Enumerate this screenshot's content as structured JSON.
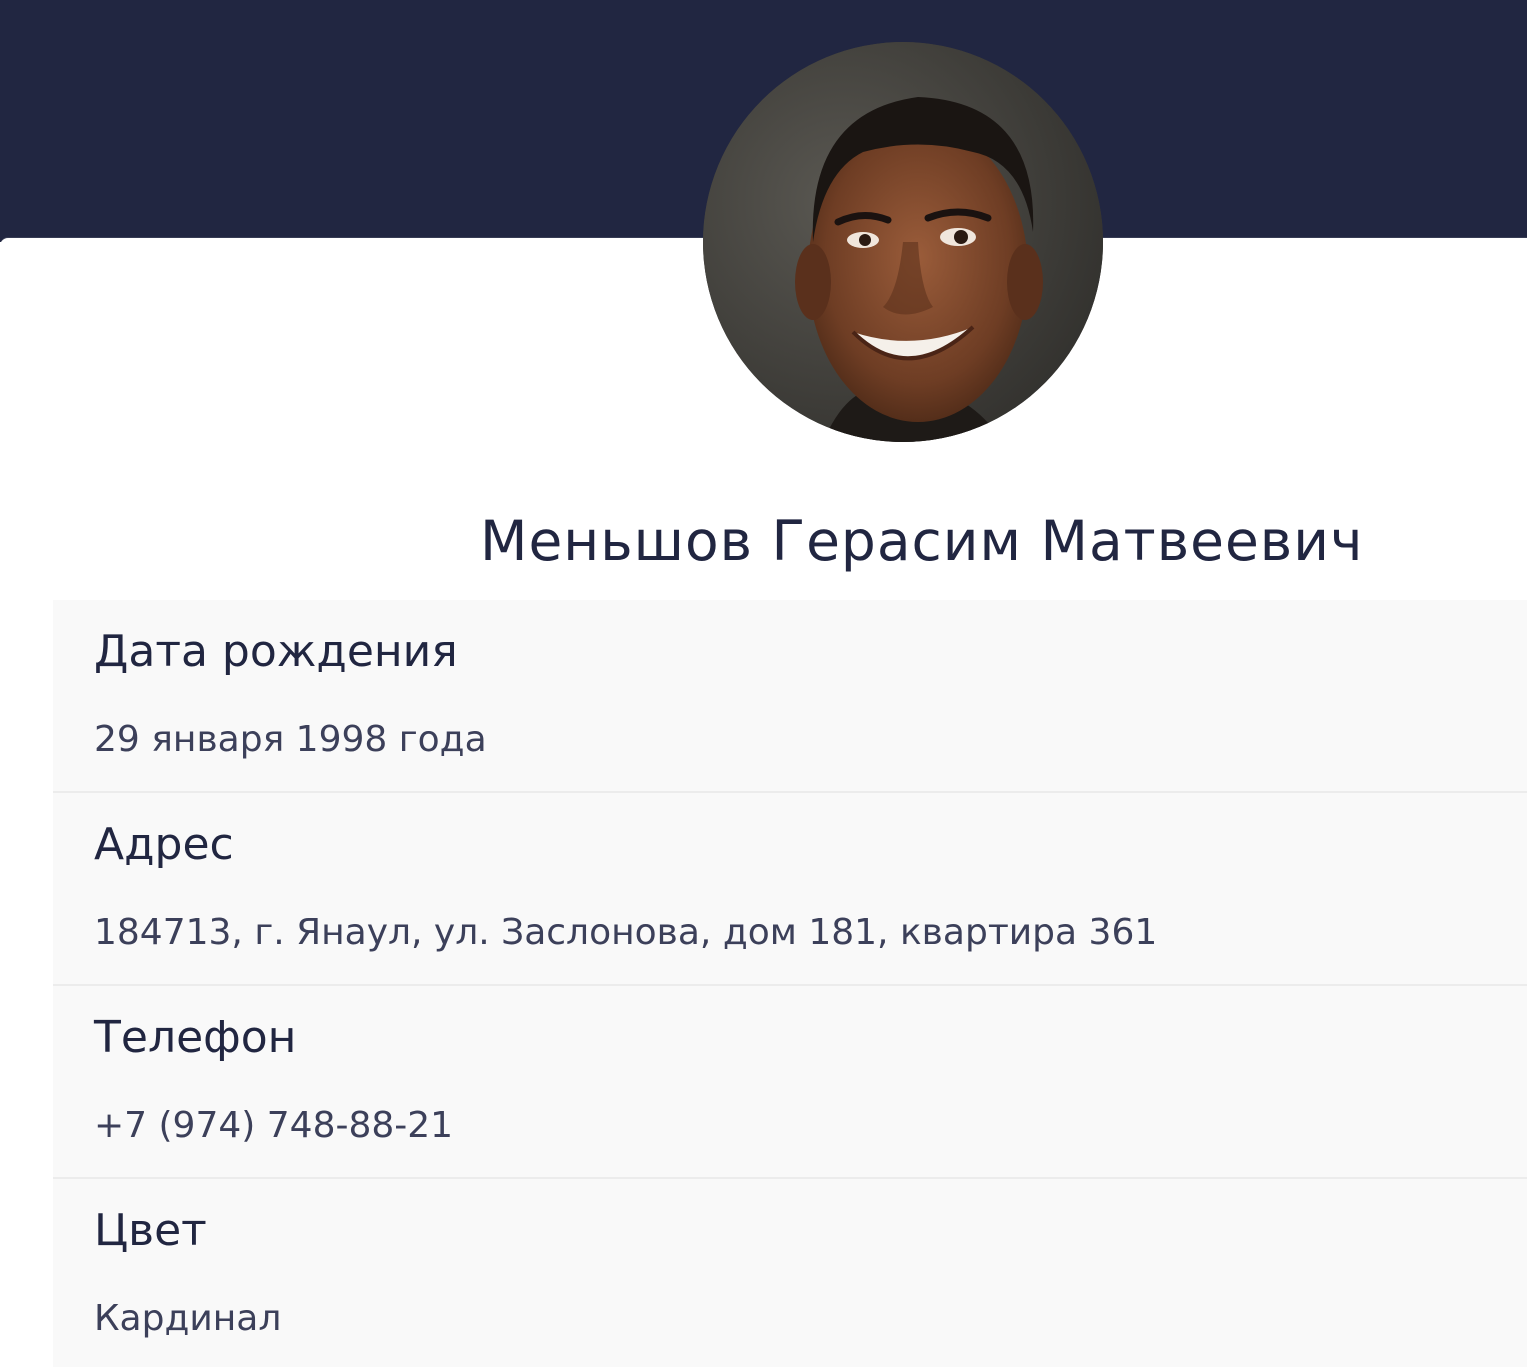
{
  "profile": {
    "full_name": "Меньшов Герасим Матвеевич",
    "photo": "portrait-photo"
  },
  "fields": [
    {
      "label": "Дата рождения",
      "value": "29 января 1998 года"
    },
    {
      "label": "Адрес",
      "value": "184713, г. Янаул, ул. Заслонова, дом 181, квартира 361"
    },
    {
      "label": "Телефон",
      "value": "+7 (974) 748-88-21"
    },
    {
      "label": "Цвет",
      "value": "Кардинал"
    }
  ],
  "colors": {
    "header": "#212641",
    "text_primary": "#212641",
    "text_secondary": "#3c405a",
    "row_background": "#f9f9f9"
  }
}
